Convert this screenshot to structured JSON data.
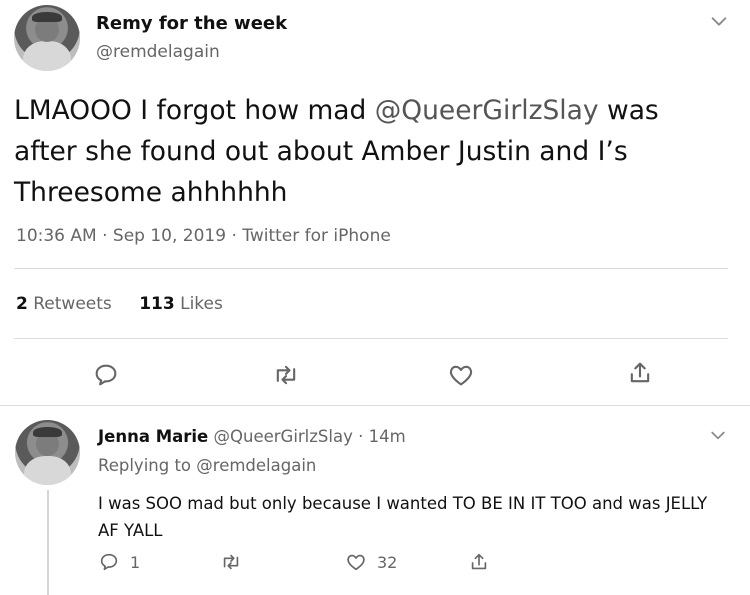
{
  "tweet": {
    "author_name": "Remy for the week",
    "author_handle": "@remdelagain",
    "text_before": "LMAOOO I forgot how mad ",
    "mention": "@QueerGirlzSlay",
    "text_after": " was after she found out about Amber Justin and I’s Threesome ahhhhhh",
    "meta": "10:36 AM · Sep 10, 2019 · Twitter for iPhone",
    "retweets_count": "2",
    "retweets_label": "Retweets",
    "likes_count": "113",
    "likes_label": "Likes"
  },
  "reply": {
    "author_name": "Jenna Marie",
    "author_handle": "@QueerGirlzSlay",
    "time": "· 14m",
    "replying_to": "Replying to @remdelagain",
    "text": "I was SOO mad but only because I wanted TO BE IN IT TOO and was JELLY AF YALL",
    "reply_count": "1",
    "like_count": "32"
  },
  "icons": {
    "chevron": "chevron-down-icon",
    "reply": "reply-icon",
    "retweet": "retweet-icon",
    "like": "heart-icon",
    "share": "share-icon"
  }
}
